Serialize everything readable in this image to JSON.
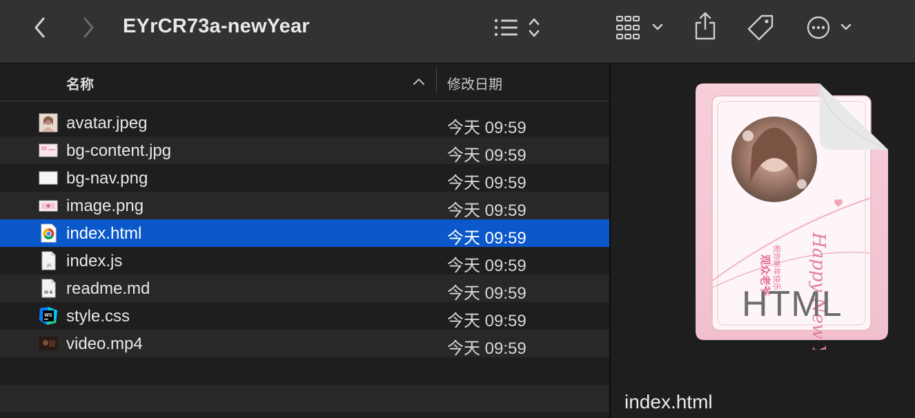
{
  "window": {
    "title": "EYrCR73a-newYear"
  },
  "toolbar": {
    "back": "back",
    "forward": "forward",
    "list_view": "list-view",
    "view_options": "grid-view",
    "share": "share",
    "tags": "tag",
    "more": "more"
  },
  "columns": {
    "name": "名称",
    "date": "修改日期"
  },
  "files": [
    {
      "name": "avatar.jpeg",
      "date": "今天 09:59",
      "icon": "image-thumbnail-icon"
    },
    {
      "name": "bg-content.jpg",
      "date": "今天 09:59",
      "icon": "image-thumbnail-icon"
    },
    {
      "name": "bg-nav.png",
      "date": "今天 09:59",
      "icon": "image-thumbnail-icon"
    },
    {
      "name": "image.png",
      "date": "今天 09:59",
      "icon": "image-thumbnail-icon"
    },
    {
      "name": "index.html",
      "date": "今天 09:59",
      "icon": "chrome-html-icon",
      "selected": true
    },
    {
      "name": "index.js",
      "date": "今天 09:59",
      "icon": "js-file-icon"
    },
    {
      "name": "readme.md",
      "date": "今天 09:59",
      "icon": "markdown-file-icon"
    },
    {
      "name": "style.css",
      "date": "今天 09:59",
      "icon": "webstorm-css-icon"
    },
    {
      "name": "video.mp4",
      "date": "今天 09:59",
      "icon": "video-thumbnail-icon"
    }
  ],
  "preview": {
    "filename": "index.html",
    "badge": "HTML",
    "card_text_1": "祝你新年快乐",
    "card_text_2": "观众老爷",
    "card_script": "Happy New Year"
  },
  "colors": {
    "selection": "#0a58c9",
    "toolbar": "#323232",
    "background": "#1e1e1e"
  }
}
